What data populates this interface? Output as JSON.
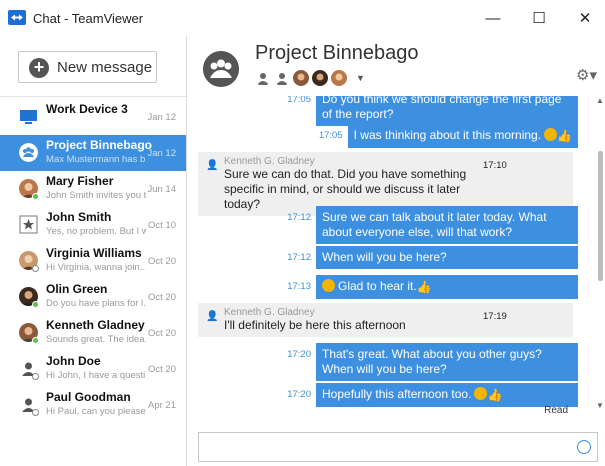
{
  "window": {
    "title": "Chat - TeamViewer",
    "minimize": "—",
    "maximize": "☐",
    "close": "✕"
  },
  "sidebar": {
    "new_message": "New message",
    "conversations": [
      {
        "name": "Work Device 3",
        "preview": "",
        "date": "Jan 12",
        "icon": "monitor-icon"
      },
      {
        "name": "Project Binnebago",
        "preview": "Max Mustermann has b...",
        "date": "Jan 12",
        "icon": "group-icon",
        "selected": true
      },
      {
        "name": "Mary Fisher",
        "preview": "John Smith invites you t...",
        "date": "Jun 14",
        "icon": "avatar",
        "status": "online"
      },
      {
        "name": "John Smith",
        "preview": "Yes, no problem. But I w...",
        "date": "Oct 10",
        "icon": "star-icon"
      },
      {
        "name": "Virginia Williams",
        "preview": "Hi Virginia, wanna join...",
        "date": "Oct 20",
        "icon": "avatar",
        "status": "offline"
      },
      {
        "name": "Olin Green",
        "preview": "Do you have plans for l...",
        "date": "Oct 20",
        "icon": "avatar",
        "status": "online"
      },
      {
        "name": "Kenneth Gladney",
        "preview": "Sounds great. The idea...",
        "date": "Oct 20",
        "icon": "avatar",
        "status": "online"
      },
      {
        "name": "John Doe",
        "preview": "Hi John, I have a questi...",
        "date": "Oct 20",
        "icon": "avatar",
        "status": "offline"
      },
      {
        "name": "Paul Goodman",
        "preview": "Hi Paul, can you please...",
        "date": "Apr 21",
        "icon": "avatar",
        "status": "offline"
      }
    ]
  },
  "chat": {
    "title": "Project Binnebago",
    "messages": [
      {
        "dir": "out",
        "time": "17:05",
        "text": "Do you think we should change the first page of the report?"
      },
      {
        "dir": "out",
        "time": "17:05",
        "text": "I was thinking about it this morning."
      },
      {
        "dir": "in",
        "sender": "Kenneth G. Gladney",
        "time": "17:10",
        "text": "Sure we can do that. Did you have something specific in mind, or should we discuss it later today?"
      },
      {
        "dir": "out",
        "time": "17:12",
        "text": "Sure we can talk about it later today. What about everyone else, will that work?"
      },
      {
        "dir": "out",
        "time": "17:12",
        "text": "When will you be here?"
      },
      {
        "dir": "out",
        "time": "17:13",
        "text": "Glad to hear it."
      },
      {
        "dir": "in",
        "sender": "Kenneth G. Gladney",
        "time": "17:19",
        "text": "I'll definitely be here this afternoon"
      },
      {
        "dir": "out",
        "time": "17:20",
        "text": "That's great. What about you other guys? When will you be here?"
      },
      {
        "dir": "out",
        "time": "17:20",
        "text": "Hopefully this afternoon too."
      }
    ],
    "read_status": "Read",
    "input_value": ""
  },
  "colors": {
    "accent": "#3d8fe0",
    "incoming_bubble": "#efefef",
    "online": "#5cc150"
  }
}
